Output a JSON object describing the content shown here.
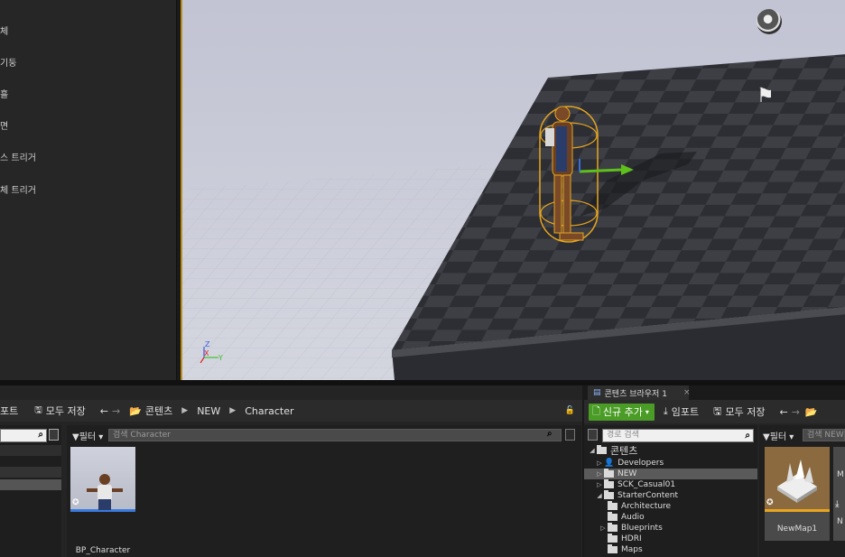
{
  "placement_panel": {
    "items": [
      {
        "label": "체"
      },
      {
        "label": "기둥"
      },
      {
        "label": "흘"
      },
      {
        "label": "면"
      },
      {
        "label": "스 트리거"
      },
      {
        "label": "체 트리거"
      }
    ]
  },
  "viewport": {
    "axis": {
      "z": "Z",
      "y": "Y",
      "x": "X"
    },
    "player_start_icon": "flag-icon",
    "sky_icon": "sphere-reflection-icon"
  },
  "content_browser_left": {
    "toolbar": {
      "import_label": "포트",
      "save_all_label": "모두 저장",
      "breadcrumb": [
        "콘텐츠",
        "NEW",
        "Character"
      ]
    },
    "filter_label": "필터",
    "search_placeholder": "검색 Character",
    "assets": [
      {
        "name": "BP_Character"
      }
    ]
  },
  "content_browser_right": {
    "tab_title": "콘텐츠 브라우저 1",
    "toolbar": {
      "add_new_label": "신규 추가",
      "import_label": "임포트",
      "save_all_label": "모두 저장"
    },
    "path_search_placeholder": "경로 검색",
    "filter_label": "필터",
    "asset_search_placeholder": "검색 NEW",
    "tree": [
      {
        "label": "콘텐츠",
        "level": 0,
        "expanded": true
      },
      {
        "label": "Developers",
        "level": 1,
        "expanded": false
      },
      {
        "label": "NEW",
        "level": 1,
        "expanded": false,
        "selected": true
      },
      {
        "label": "SCK_Casual01",
        "level": 1,
        "expanded": false
      },
      {
        "label": "StarterContent",
        "level": 1,
        "expanded": true
      },
      {
        "label": "Architecture",
        "level": 2,
        "expanded": false
      },
      {
        "label": "Audio",
        "level": 2,
        "expanded": false
      },
      {
        "label": "Blueprints",
        "level": 2,
        "expanded": false
      },
      {
        "label": "HDRI",
        "level": 2,
        "expanded": false
      },
      {
        "label": "Maps",
        "level": 2,
        "expanded": false
      }
    ],
    "assets": [
      {
        "name": "NewMap1"
      },
      {
        "name": "M"
      },
      {
        "name": "N"
      }
    ]
  },
  "colors": {
    "accent_green": "#4a9c26",
    "selection_outline": "#e7a520",
    "panel_bg": "#242424"
  }
}
